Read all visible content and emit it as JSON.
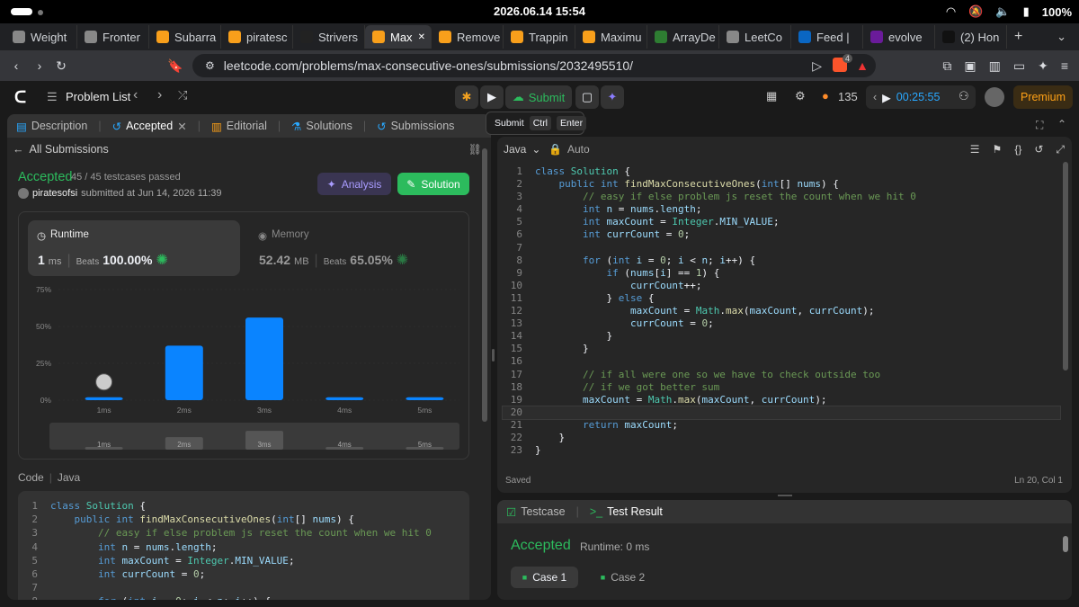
{
  "system": {
    "datetime": "2026.06.14 15:54",
    "battery": "100%"
  },
  "tabs": [
    {
      "label": "Weight",
      "color": "#888"
    },
    {
      "label": "Fronter",
      "color": "#888"
    },
    {
      "label": "Subarra",
      "color": "#f89f1b"
    },
    {
      "label": "piratesc",
      "color": "#f89f1b"
    },
    {
      "label": "Strivers",
      "color": "#222"
    },
    {
      "label": "Max",
      "color": "#f89f1b",
      "active": true
    },
    {
      "label": "Remove",
      "color": "#f89f1b"
    },
    {
      "label": "Trappin",
      "color": "#f89f1b"
    },
    {
      "label": "Maximu",
      "color": "#f89f1b"
    },
    {
      "label": "ArrayDe",
      "color": "#2e7d32"
    },
    {
      "label": "LeetCo",
      "color": "#888"
    },
    {
      "label": "Feed |",
      "color": "#0a66c2"
    },
    {
      "label": "evolve",
      "color": "#6a1b9a"
    },
    {
      "label": "(2) Hon",
      "color": "#111"
    }
  ],
  "url": "leetcode.com/problems/max-consecutive-ones/submissions/2032495510/",
  "brave_badge": "4",
  "lc_nav": {
    "problem_list": "Problem List",
    "submit": "Submit",
    "streak": "135",
    "timer": "00:25:55",
    "premium": "Premium"
  },
  "tooltip": {
    "label": "Submit",
    "key1": "Ctrl",
    "key2": "Enter"
  },
  "left_tabs": {
    "description": "Description",
    "accepted": "Accepted",
    "editorial": "Editorial",
    "solutions": "Solutions",
    "submissions": "Submissions"
  },
  "submission": {
    "back": "All Submissions",
    "status": "Accepted",
    "testcases": "45 / 45 testcases passed",
    "user": "piratesofsi",
    "submitted": "submitted at Jun 14, 2026 11:39",
    "analysis": "Analysis",
    "solution": "Solution",
    "runtime": {
      "label": "Runtime",
      "value": "1",
      "unit": "ms",
      "beats_label": "Beats",
      "beats": "100.00%"
    },
    "memory": {
      "label": "Memory",
      "value": "52.42",
      "unit": "MB",
      "beats_label": "Beats",
      "beats": "65.05%"
    }
  },
  "chart_data": {
    "type": "bar",
    "categories": [
      "1ms",
      "2ms",
      "3ms",
      "4ms",
      "5ms"
    ],
    "values": [
      2,
      37,
      56,
      2,
      2
    ],
    "yticks": [
      "75%",
      "50%",
      "25%",
      "0%"
    ],
    "ylim": [
      0,
      75
    ],
    "highlight_category": "1ms",
    "minimap_labels": [
      "1ms",
      "2ms",
      "3ms",
      "4ms",
      "5ms"
    ],
    "color": "#0a84ff"
  },
  "code_section": {
    "code_label": "Code",
    "lang": "Java"
  },
  "editor": {
    "lang": "Java",
    "auto": "Auto",
    "status": "Saved",
    "cursor": "Ln 20, Col 1"
  },
  "code_lines": [
    "class Solution {",
    "    public int findMaxConsecutiveOnes(int[] nums) {",
    "        // easy if else problem js reset the count when we hit 0",
    "        int n = nums.length;",
    "        int maxCount = Integer.MIN_VALUE;",
    "        int currCount = 0;",
    "",
    "        for (int i = 0; i < n; i++) {",
    "            if (nums[i] == 1) {",
    "                currCount++;",
    "            } else {",
    "                maxCount = Math.max(maxCount, currCount);",
    "                currCount = 0;",
    "            }",
    "        }",
    "",
    "        // if all were one so we have to check outside too",
    "        // if we got better sum",
    "        maxCount = Math.max(maxCount, currCount);",
    "",
    "        return maxCount;",
    "    }",
    "}"
  ],
  "testpanel": {
    "testcase": "Testcase",
    "result_tab": "Test Result",
    "status": "Accepted",
    "runtime": "Runtime: 0 ms",
    "case1": "Case 1",
    "case2": "Case 2"
  }
}
